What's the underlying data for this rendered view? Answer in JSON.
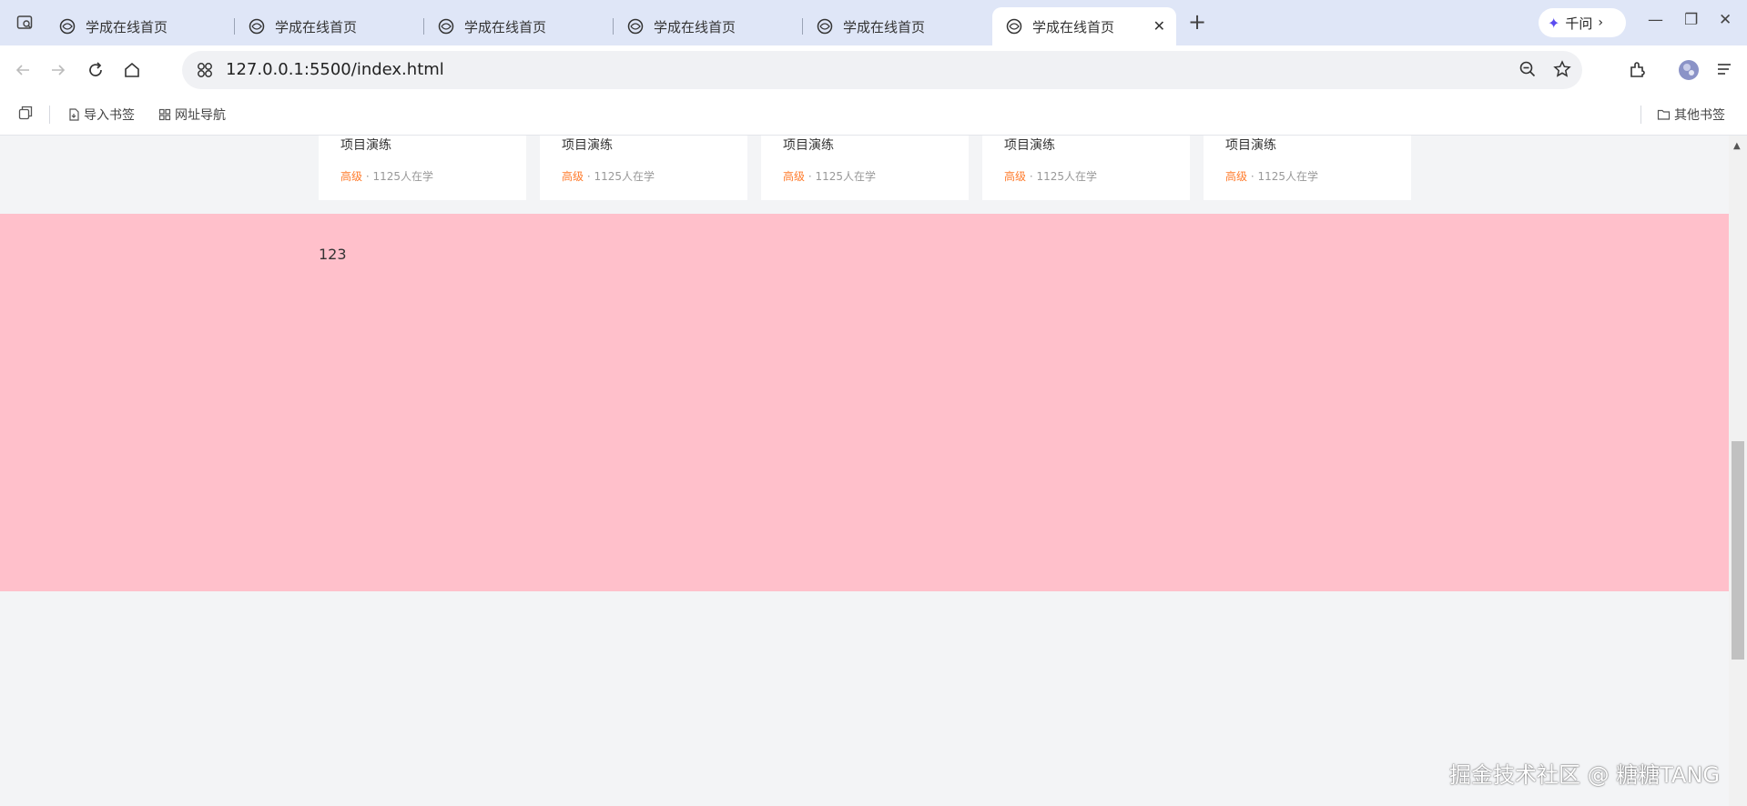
{
  "tabs": [
    {
      "title": "学成在线首页"
    },
    {
      "title": "学成在线首页"
    },
    {
      "title": "学成在线首页"
    },
    {
      "title": "学成在线首页"
    },
    {
      "title": "学成在线首页"
    },
    {
      "title": "学成在线首页",
      "active": true
    }
  ],
  "toolbar": {
    "url": "127.0.0.1:5500/index.html",
    "qianwen_label": "千问"
  },
  "bookmarks": {
    "import_label": "导入书签",
    "nav_label": "网址导航",
    "other_label": "其他书签"
  },
  "courses": [
    {
      "title": "项目演练",
      "level": "高级",
      "students": " · 1125人在学"
    },
    {
      "title": "项目演练",
      "level": "高级",
      "students": " · 1125人在学"
    },
    {
      "title": "项目演练",
      "level": "高级",
      "students": " · 1125人在学"
    },
    {
      "title": "项目演练",
      "level": "高级",
      "students": " · 1125人在学"
    },
    {
      "title": "项目演练",
      "level": "高级",
      "students": " · 1125人在学"
    }
  ],
  "band": {
    "text": "123"
  },
  "watermark": "掘金技术社区 @ 糖糖TANG",
  "colors": {
    "band": "#ffc0cb",
    "level": "#ff7c2d",
    "tabstrip": "#dfe6f7"
  }
}
